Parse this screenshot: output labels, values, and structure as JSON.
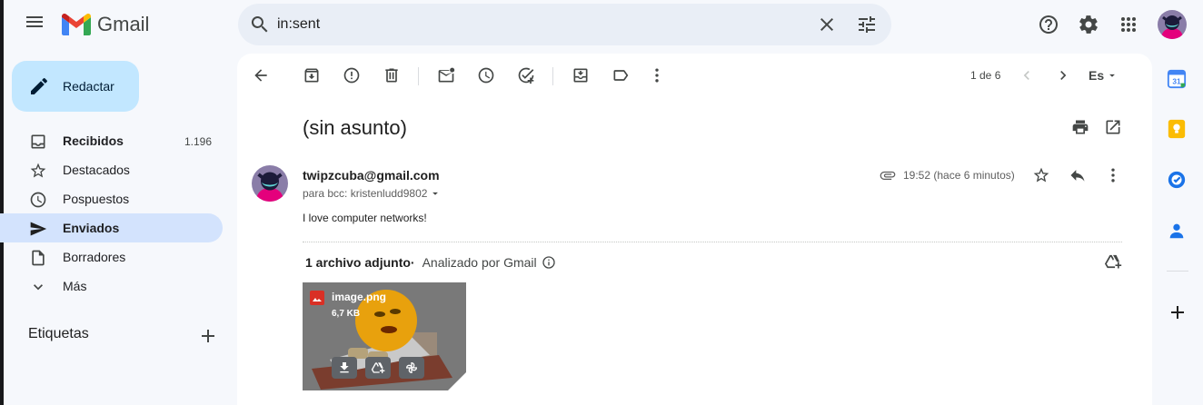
{
  "header": {
    "app_name": "Gmail",
    "search_value": "in:sent"
  },
  "sidebar": {
    "compose_label": "Redactar",
    "items": [
      {
        "label": "Recibidos",
        "count": "1.196"
      },
      {
        "label": "Destacados"
      },
      {
        "label": "Pospuestos"
      },
      {
        "label": "Enviados"
      },
      {
        "label": "Borradores"
      },
      {
        "label": "Más"
      }
    ],
    "labels_heading": "Etiquetas"
  },
  "toolbar": {
    "pager": "1 de 6",
    "language": "Es"
  },
  "message": {
    "subject": "(sin asunto)",
    "sender": "twipzcuba@gmail.com",
    "recipients": "para bcc: kristenludd9802",
    "time": "19:52 (hace 6 minutos)",
    "body": "I love computer networks!"
  },
  "attachments": {
    "count_label": "1 archivo adjunto",
    "scanned_label": "Analizado por Gmail",
    "file": {
      "name": "image.png",
      "size": "6,7 KB"
    }
  },
  "colors": {
    "compose_bg": "#c2e7ff",
    "active_nav_bg": "#d3e3fd",
    "search_bg": "#e9eef6",
    "page_bg": "#f6f8fc"
  }
}
